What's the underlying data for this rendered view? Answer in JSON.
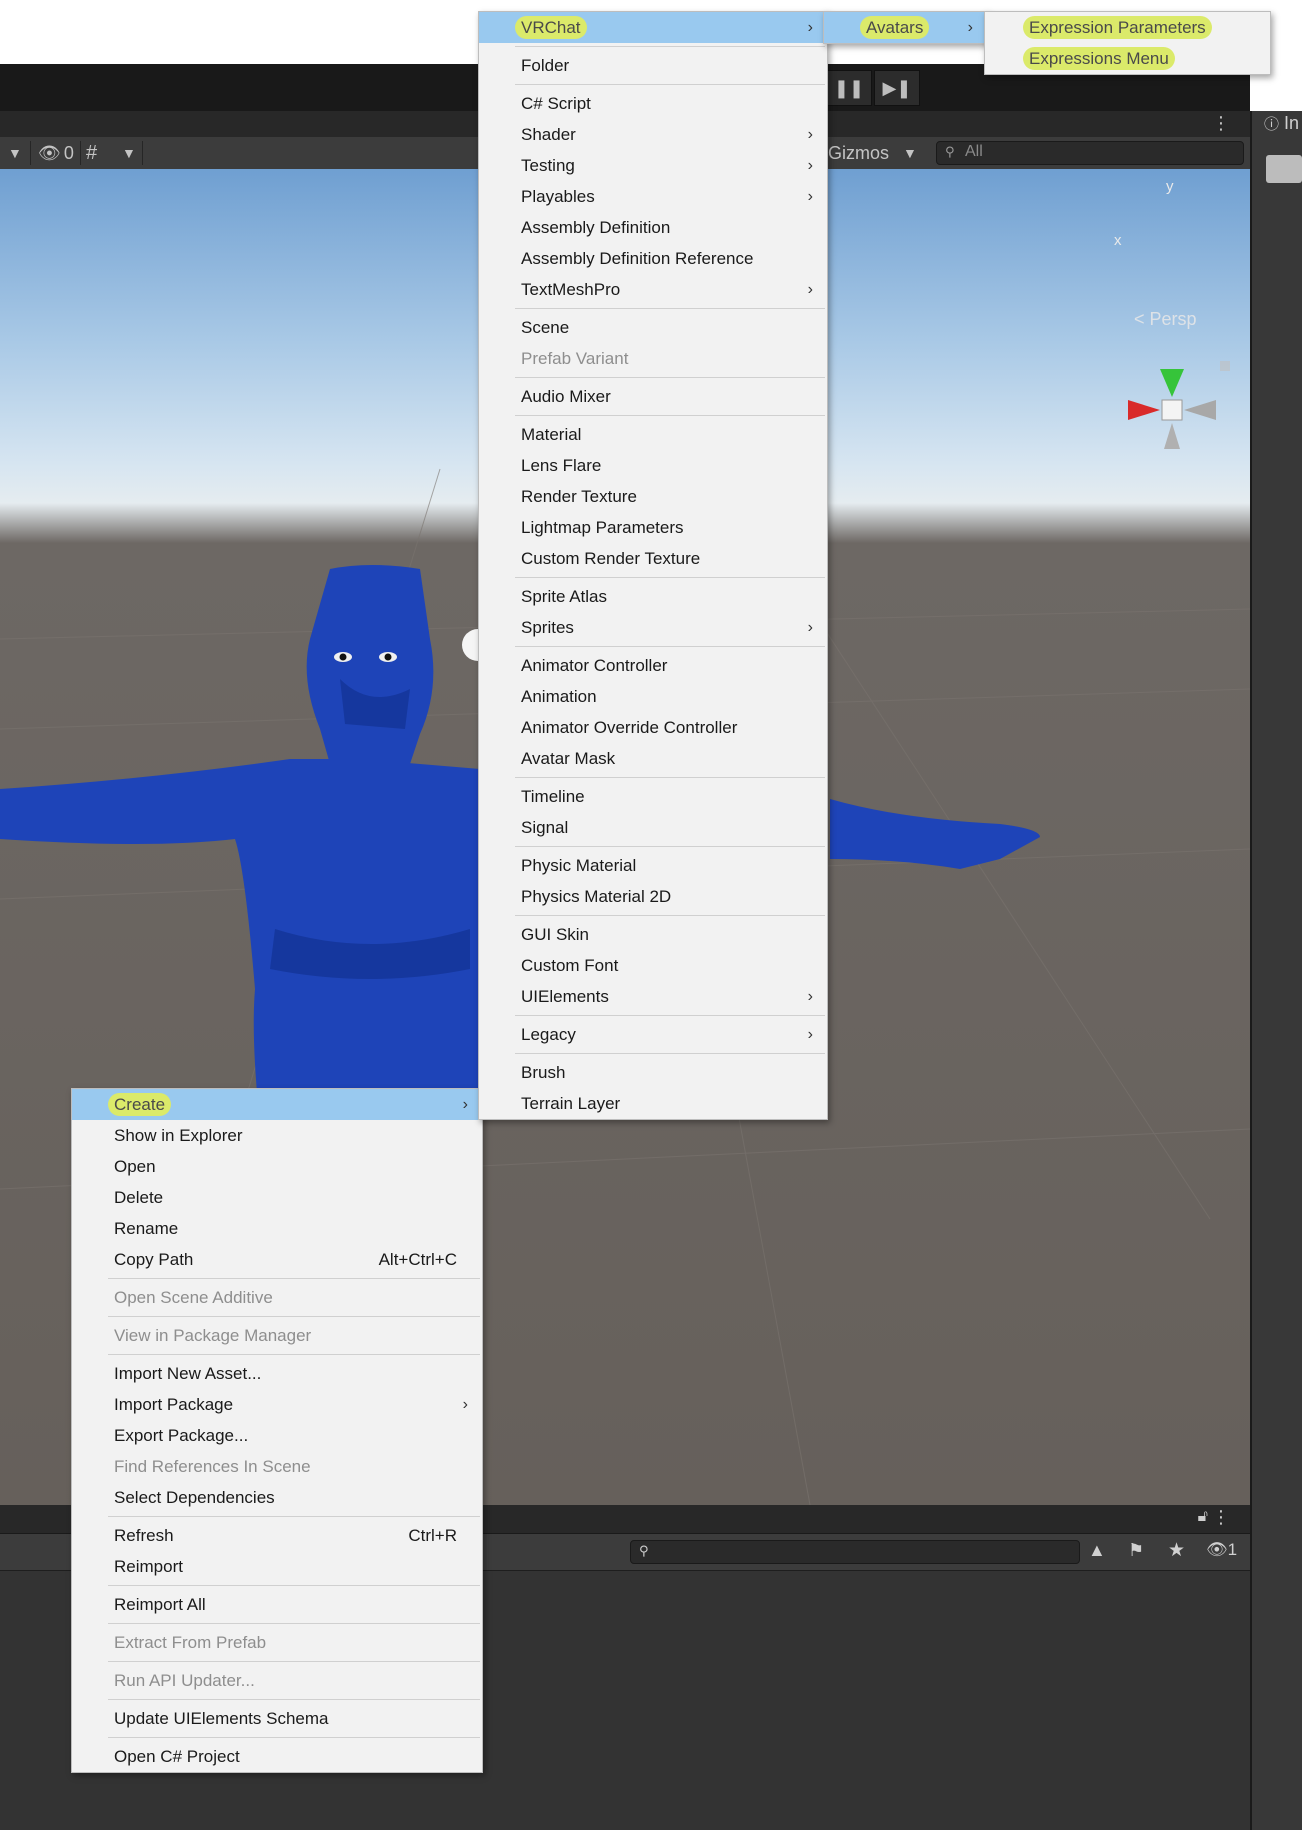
{
  "toolbar": {
    "hidden_count": "0",
    "gizmos_label": "Gizmos",
    "search_placeholder": "All",
    "inspector_tab": "In"
  },
  "gizmo": {
    "x_label": "x",
    "y_label": "y",
    "view_mode": "Persp"
  },
  "bottom_panel": {
    "hidden_count": "1"
  },
  "context_menu": {
    "items": [
      {
        "label": "Create",
        "submenu": true,
        "active": true
      },
      {
        "label": "Show in Explorer"
      },
      {
        "label": "Open"
      },
      {
        "label": "Delete"
      },
      {
        "label": "Rename"
      },
      {
        "label": "Copy Path",
        "shortcut": "Alt+Ctrl+C"
      },
      {
        "separator": true
      },
      {
        "label": "Open Scene Additive",
        "disabled": true
      },
      {
        "separator": true
      },
      {
        "label": "View in Package Manager",
        "disabled": true
      },
      {
        "separator": true
      },
      {
        "label": "Import New Asset..."
      },
      {
        "label": "Import Package",
        "submenu": true
      },
      {
        "label": "Export Package..."
      },
      {
        "label": "Find References In Scene",
        "disabled": true
      },
      {
        "label": "Select Dependencies"
      },
      {
        "separator": true
      },
      {
        "label": "Refresh",
        "shortcut": "Ctrl+R"
      },
      {
        "label": "Reimport"
      },
      {
        "separator": true
      },
      {
        "label": "Reimport All"
      },
      {
        "separator": true
      },
      {
        "label": "Extract From Prefab",
        "disabled": true
      },
      {
        "separator": true
      },
      {
        "label": "Run API Updater...",
        "disabled": true
      },
      {
        "separator": true
      },
      {
        "label": "Update UIElements Schema"
      },
      {
        "separator": true
      },
      {
        "label": "Open C# Project"
      }
    ]
  },
  "create_menu": {
    "items": [
      {
        "label": "VRChat",
        "submenu": true,
        "active": true
      },
      {
        "separator": true
      },
      {
        "label": "Folder"
      },
      {
        "separator": true
      },
      {
        "label": "C# Script"
      },
      {
        "label": "Shader",
        "submenu": true
      },
      {
        "label": "Testing",
        "submenu": true
      },
      {
        "label": "Playables",
        "submenu": true
      },
      {
        "label": "Assembly Definition"
      },
      {
        "label": "Assembly Definition Reference"
      },
      {
        "label": "TextMeshPro",
        "submenu": true
      },
      {
        "separator": true
      },
      {
        "label": "Scene"
      },
      {
        "label": "Prefab Variant",
        "disabled": true
      },
      {
        "separator": true
      },
      {
        "label": "Audio Mixer"
      },
      {
        "separator": true
      },
      {
        "label": "Material"
      },
      {
        "label": "Lens Flare"
      },
      {
        "label": "Render Texture"
      },
      {
        "label": "Lightmap Parameters"
      },
      {
        "label": "Custom Render Texture"
      },
      {
        "separator": true
      },
      {
        "label": "Sprite Atlas"
      },
      {
        "label": "Sprites",
        "submenu": true
      },
      {
        "separator": true
      },
      {
        "label": "Animator Controller"
      },
      {
        "label": "Animation"
      },
      {
        "label": "Animator Override Controller"
      },
      {
        "label": "Avatar Mask"
      },
      {
        "separator": true
      },
      {
        "label": "Timeline"
      },
      {
        "label": "Signal"
      },
      {
        "separator": true
      },
      {
        "label": "Physic Material"
      },
      {
        "label": "Physics Material 2D"
      },
      {
        "separator": true
      },
      {
        "label": "GUI Skin"
      },
      {
        "label": "Custom Font"
      },
      {
        "label": "UIElements",
        "submenu": true
      },
      {
        "separator": true
      },
      {
        "label": "Legacy",
        "submenu": true
      },
      {
        "separator": true
      },
      {
        "label": "Brush"
      },
      {
        "label": "Terrain Layer"
      }
    ]
  },
  "vrchat_menu": {
    "items": [
      {
        "label": "Avatars",
        "submenu": true,
        "active": true
      }
    ]
  },
  "avatars_menu": {
    "items": [
      {
        "label": "Expression Parameters"
      },
      {
        "label": "Expressions Menu"
      }
    ]
  },
  "colors": {
    "menu_bg": "#f2f2f2",
    "menu_active": "#99c9ef",
    "highlighter": "#dbea6a",
    "avatar_blue": "#1e44b8"
  }
}
